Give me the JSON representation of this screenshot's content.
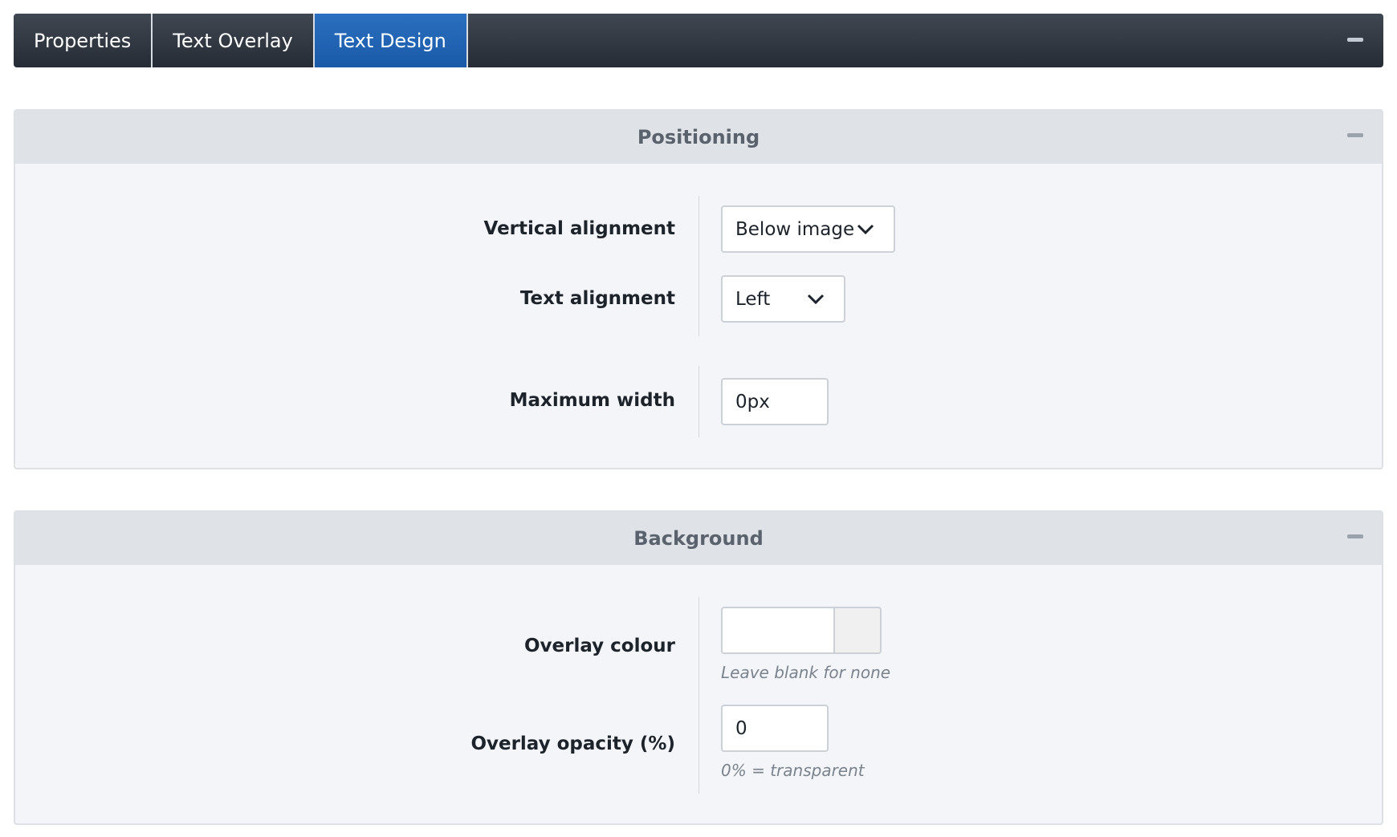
{
  "tabs": [
    {
      "label": "Properties",
      "active": false
    },
    {
      "label": "Text Overlay",
      "active": false
    },
    {
      "label": "Text Design",
      "active": true
    }
  ],
  "positioning": {
    "title": "Positioning",
    "vertical_alignment": {
      "label": "Vertical alignment",
      "value": "Below image"
    },
    "text_alignment": {
      "label": "Text alignment",
      "value": "Left"
    },
    "maximum_width": {
      "label": "Maximum width",
      "value": "0px"
    }
  },
  "background": {
    "title": "Background",
    "overlay_colour": {
      "label": "Overlay colour",
      "value": "",
      "hint": "Leave blank for none",
      "swatch_color": "#f0f0f0"
    },
    "overlay_opacity": {
      "label": "Overlay opacity (%)",
      "value": "0",
      "hint": "0% = transparent"
    }
  },
  "colors": {
    "tabbar": "#262c35",
    "active_tab": "#1a5aa8",
    "panel_bg": "#f3f5f8",
    "panel_head_bg": "#dfe2e6"
  },
  "icons": {
    "collapse": "minus-icon",
    "dropdown": "chevron-down-icon"
  }
}
